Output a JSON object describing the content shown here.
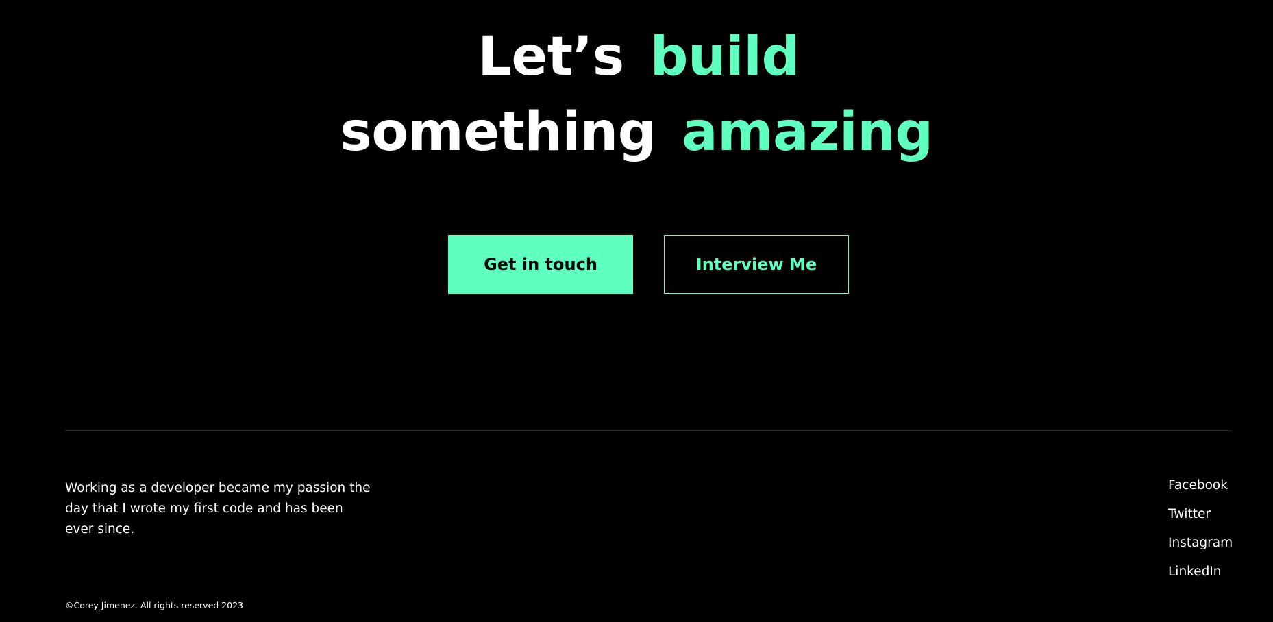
{
  "hero": {
    "line1_white": "Let’s",
    "line1_accent": "build",
    "line2_white": "something",
    "line2_accent": "amazing"
  },
  "cta": {
    "primary_label": "Get in touch",
    "secondary_label": "Interview Me"
  },
  "footer": {
    "blurb": "Working as a developer became my passion the day that I wrote my first code and has been ever since.",
    "social": [
      "Facebook",
      "Twitter",
      "Instagram",
      "LinkedIn"
    ],
    "copyright": "©Corey Jimenez. All rights reserved 2023"
  },
  "colors": {
    "background": "#000000",
    "accent": "#5effbf",
    "text": "#ffffff",
    "divider": "#262626"
  }
}
